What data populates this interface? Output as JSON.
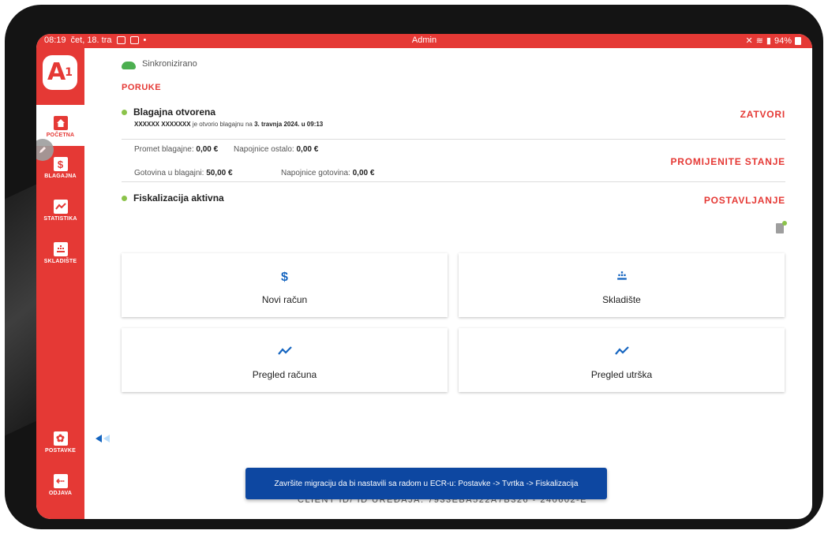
{
  "status_bar": {
    "time": "08:19",
    "date": "čet, 18. tra",
    "title": "Admin",
    "battery": "94%"
  },
  "sidebar": {
    "logo_text": "A",
    "logo_sup": "1",
    "items": [
      {
        "label": "POČETNA",
        "icon": "home-icon"
      },
      {
        "label": "BLAGAJNA",
        "icon": "dollar-icon"
      },
      {
        "label": "STATISTIKA",
        "icon": "chart-icon"
      },
      {
        "label": "SKLADIŠTE",
        "icon": "warehouse-icon"
      },
      {
        "label": "POSTAVKE",
        "icon": "gear-icon"
      },
      {
        "label": "ODJAVA",
        "icon": "logout-icon"
      }
    ]
  },
  "sync": {
    "label": "Sinkronizirano"
  },
  "messages": {
    "heading": "PORUKE",
    "register": {
      "title": "Blagajna otvorena",
      "opened_by": "XXXXXX XXXXXXX",
      "opened_text": " je otvorio blagajnu na ",
      "opened_at": "3. travnja 2024. u 09:13",
      "action": "ZATVORI"
    },
    "stats": {
      "promet_label": "Promet blagajne:",
      "promet_value": "0,00 €",
      "napojnice_ostalo_label": "Napojnice ostalo:",
      "napojnice_ostalo_value": "0,00 €",
      "gotovina_label": "Gotovina u blagajni:",
      "gotovina_value": "50,00 €",
      "napojnice_gotovina_label": "Napojnice gotovina:",
      "napojnice_gotovina_value": "0,00 €",
      "action": "PROMIJENITE STANJE"
    },
    "fiscal": {
      "title": "Fiskalizacija aktivna",
      "action": "POSTAVLJANJE"
    }
  },
  "tiles": [
    {
      "label": "Novi račun",
      "icon": "dollar-icon"
    },
    {
      "label": "Skladište",
      "icon": "warehouse-icon"
    },
    {
      "label": "Pregled računa",
      "icon": "trend-icon"
    },
    {
      "label": "Pregled utrška",
      "icon": "trend-icon"
    }
  ],
  "footer": {
    "client_id": "CLIENT ID/ ID UREĐAJA: 7933EBA522A7B326 - 240602-E",
    "snackbar": "Završite migraciju da bi nastavili sa radom u ECR-u: Postavke -> Tvrtka -> Fiskalizacija"
  },
  "colors": {
    "brand": "#e53935",
    "accent": "#1565c0",
    "ok": "#8bc34a"
  }
}
